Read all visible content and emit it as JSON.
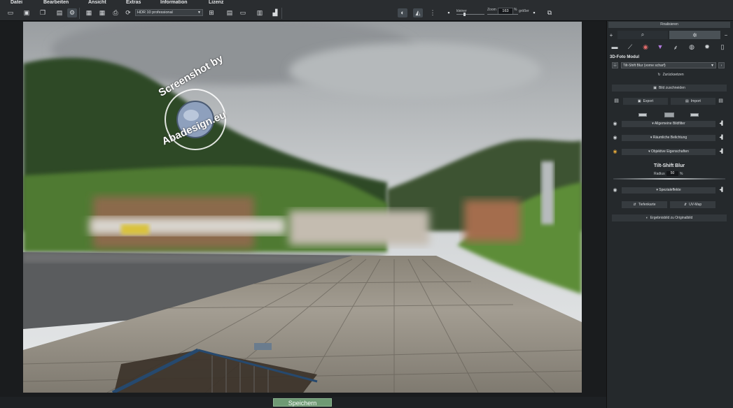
{
  "menu": [
    "Datei",
    "Bearbeiten",
    "Ansicht",
    "Extras",
    "Information",
    "Lizenz"
  ],
  "toolbar": {
    "preset": "HDR 10 professional",
    "zoom_label": "Zoom",
    "zoom_value": "163",
    "zoom_unit": "%",
    "smaller_label": "kleiner",
    "larger_label": "größer"
  },
  "panel": {
    "finalize": "Finalisieren",
    "module_title": "3D-Foto Modul",
    "module_preset": "Tilt-Shift Blur (vorne scharf)",
    "reset": "Zurücksetzen",
    "crop": "Bild zuschneiden",
    "export": "Export",
    "import": "Import",
    "sections": {
      "general": "Allgemeine Bildfilter",
      "spatial": "Räumliche Belichtung",
      "lens": "Objektive Eigenschaften"
    },
    "tilt_shift_title": "Tilt-Shift Blur",
    "radius_label": "Radius",
    "radius_value": "50",
    "radius_unit": "%",
    "special_effects": "Spezialeffekte",
    "depth_map": "Tiefenkarte",
    "uv_map": "UV-Map",
    "compare": "Ergebnisbild zu Originalbild"
  },
  "watermark": {
    "top": "Screenshot by",
    "bottom": "Abadesign.eu"
  },
  "save_button": "Speichern",
  "colors": {
    "accent_green": "#6f9a74",
    "panel_bg": "#25292c",
    "toolbar_bg": "#2a2d30"
  }
}
